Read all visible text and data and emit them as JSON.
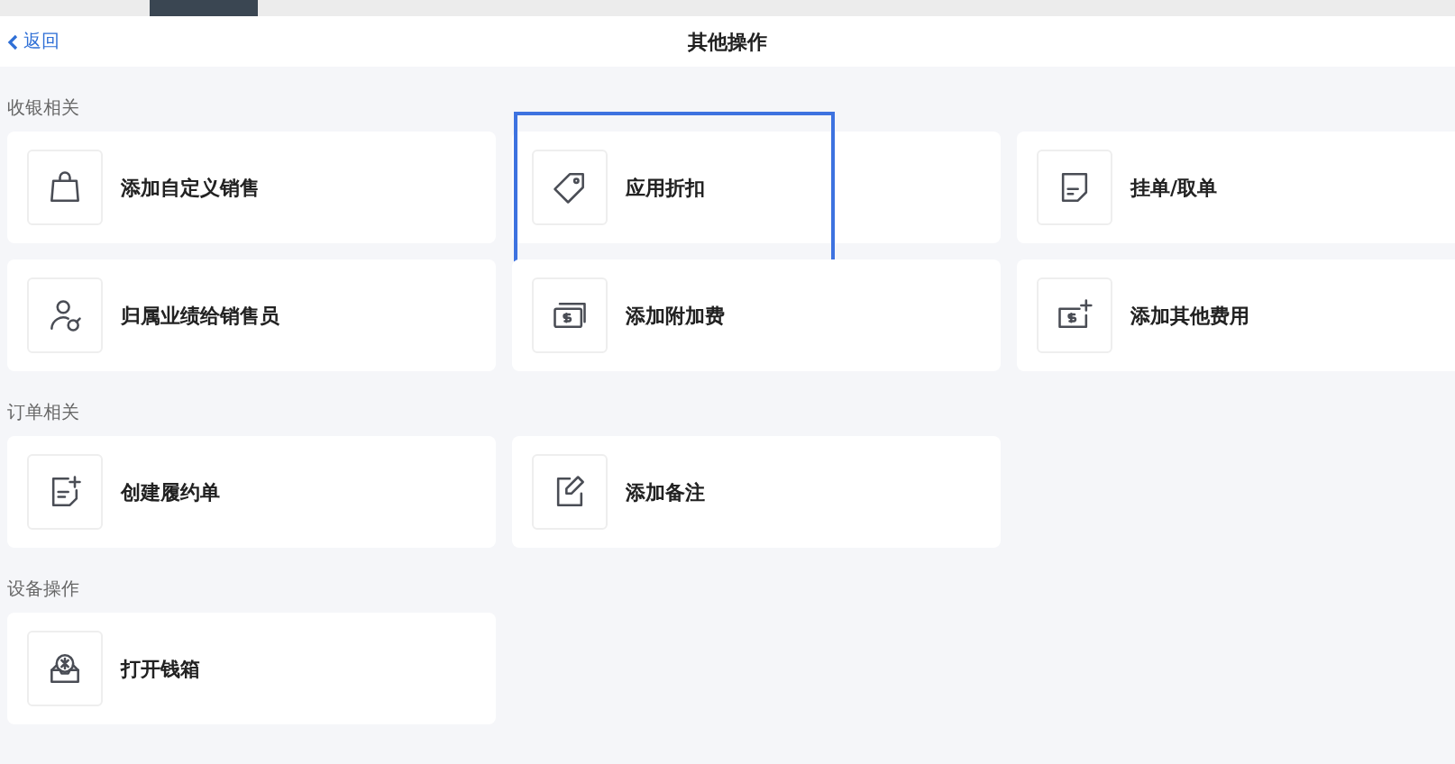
{
  "header": {
    "back": "返回",
    "title": "其他操作"
  },
  "sections": [
    {
      "title": "收银相关",
      "items": [
        {
          "label": "添加自定义销售",
          "kind": "bag",
          "highlighted": false
        },
        {
          "label": "应用折扣",
          "kind": "tag",
          "highlighted": true
        },
        {
          "label": "挂单/取单",
          "kind": "note",
          "highlighted": false
        },
        {
          "label": "归属业绩给销售员",
          "kind": "person",
          "highlighted": false
        },
        {
          "label": "添加附加费",
          "kind": "cash",
          "highlighted": false
        },
        {
          "label": "添加其他费用",
          "kind": "cashplus",
          "highlighted": false
        }
      ]
    },
    {
      "title": "订单相关",
      "items": [
        {
          "label": "创建履约单",
          "kind": "docplus",
          "highlighted": false
        },
        {
          "label": "添加备注",
          "kind": "edit",
          "highlighted": false
        }
      ]
    },
    {
      "title": "设备操作",
      "items": [
        {
          "label": "打开钱箱",
          "kind": "cashbox",
          "highlighted": false
        }
      ]
    }
  ]
}
